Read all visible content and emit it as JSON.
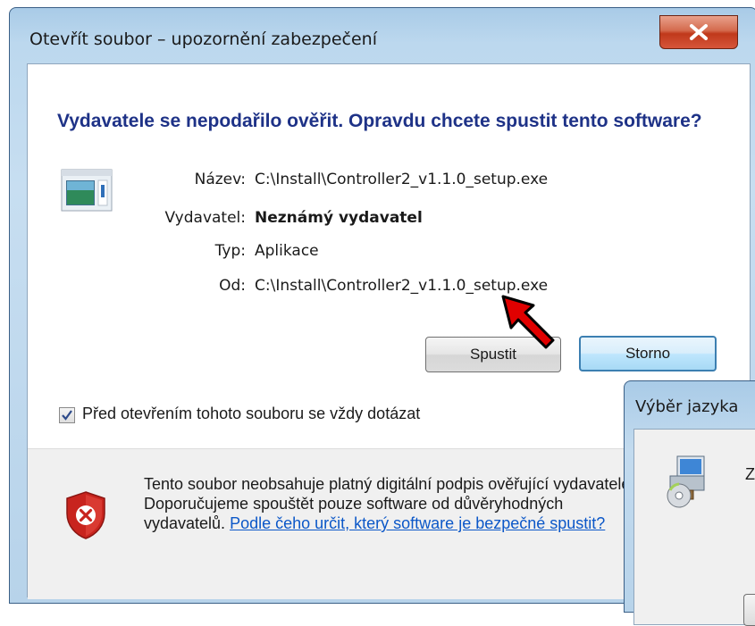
{
  "dialog": {
    "title": "Otevřít soubor – upozornění zabezpečení",
    "headline": "Vydavatele se nepodařilo ověřit. Opravdu chcete spustit tento software?",
    "icon": "application-window-icon",
    "properties": [
      {
        "label": "Název:",
        "value": "C:\\Install\\Controller2_v1.1.0_setup.exe"
      },
      {
        "label": "Vydavatel:",
        "value": "Neznámý vydavatel"
      },
      {
        "label": "Typ:",
        "value": "Aplikace"
      },
      {
        "label": "Od:",
        "value": "C:\\Install\\Controller2_v1.1.0_setup.exe"
      }
    ],
    "buttons": {
      "run": "Spustit",
      "cancel": "Storno"
    },
    "checkbox": {
      "label": "Před otevřením tohoto souboru se vždy dotázat",
      "checked": true
    },
    "warning": {
      "text": "Tento soubor neobsahuje platný digitální podpis ověřující vydavatele. Doporučujeme spouštět pouze software od důvěryhodných vydavatelů.",
      "link": "Podle čeho určit, který software je bezpečné spustit?",
      "icon": "security-shield-error-icon"
    }
  },
  "second_window": {
    "title": "Výběr jazyka",
    "text_start": "Z",
    "icon": "setup-installer-icon"
  },
  "annotation": {
    "icon": "red-arrow-pointer",
    "color": "#e00000"
  },
  "colors": {
    "headline": "#1e3287",
    "link": "#0b57c8",
    "close": "#c0391b"
  }
}
